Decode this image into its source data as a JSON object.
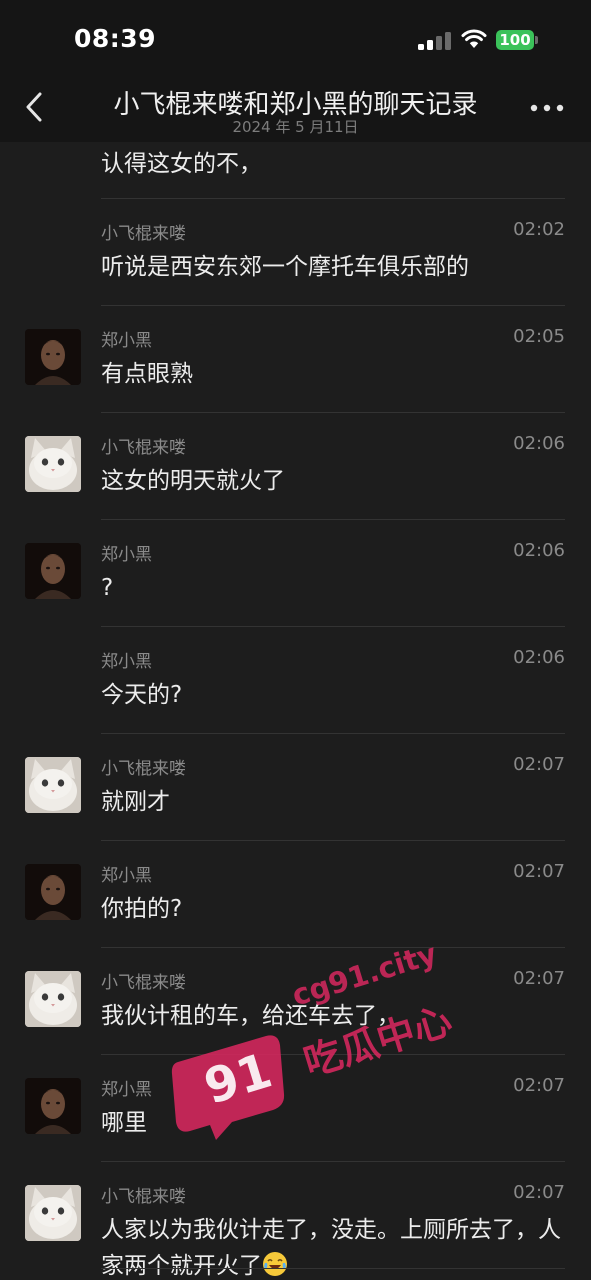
{
  "status_bar": {
    "time": "08:39",
    "battery": "100",
    "battery_color": "#3bc25a"
  },
  "nav": {
    "title": "小飞棍来喽和郑小黑的聊天记录",
    "subtitle": "2024 年 5 月11日",
    "back_icon": "chevron-left-icon",
    "more_icon": "more-dots-icon"
  },
  "chat": {
    "partial_message": "认得这女的不，",
    "messages": [
      {
        "sender": "小飞棍来喽",
        "time": "02:02",
        "text": "听说是西安东郊一个摩托车俱乐部的",
        "avatar": "none"
      },
      {
        "sender": "郑小黑",
        "time": "02:05",
        "text": "有点眼熟",
        "avatar": "man"
      },
      {
        "sender": "小飞棍来喽",
        "time": "02:06",
        "text": "这女的明天就火了",
        "avatar": "cat"
      },
      {
        "sender": "郑小黑",
        "time": "02:06",
        "text": "?",
        "avatar": "man"
      },
      {
        "sender": "郑小黑",
        "time": "02:06",
        "text": "今天的?",
        "avatar": "none"
      },
      {
        "sender": "小飞棍来喽",
        "time": "02:07",
        "text": "就刚才",
        "avatar": "cat"
      },
      {
        "sender": "郑小黑",
        "time": "02:07",
        "text": "你拍的?",
        "avatar": "man"
      },
      {
        "sender": "小飞棍来喽",
        "time": "02:07",
        "text": "我伙计租的车，给还车去了，",
        "avatar": "cat"
      },
      {
        "sender": "郑小黑",
        "time": "02:07",
        "text": "哪里",
        "avatar": "man"
      },
      {
        "sender": "小飞棍来喽",
        "time": "02:07",
        "text": "人家以为我伙计走了，没走。上厕所去了，人家两个就开火了",
        "avatar": "cat"
      }
    ]
  },
  "watermark": {
    "number": "91",
    "url": "cg91.city",
    "label": "吃瓜中心",
    "color": "#d7285f"
  }
}
